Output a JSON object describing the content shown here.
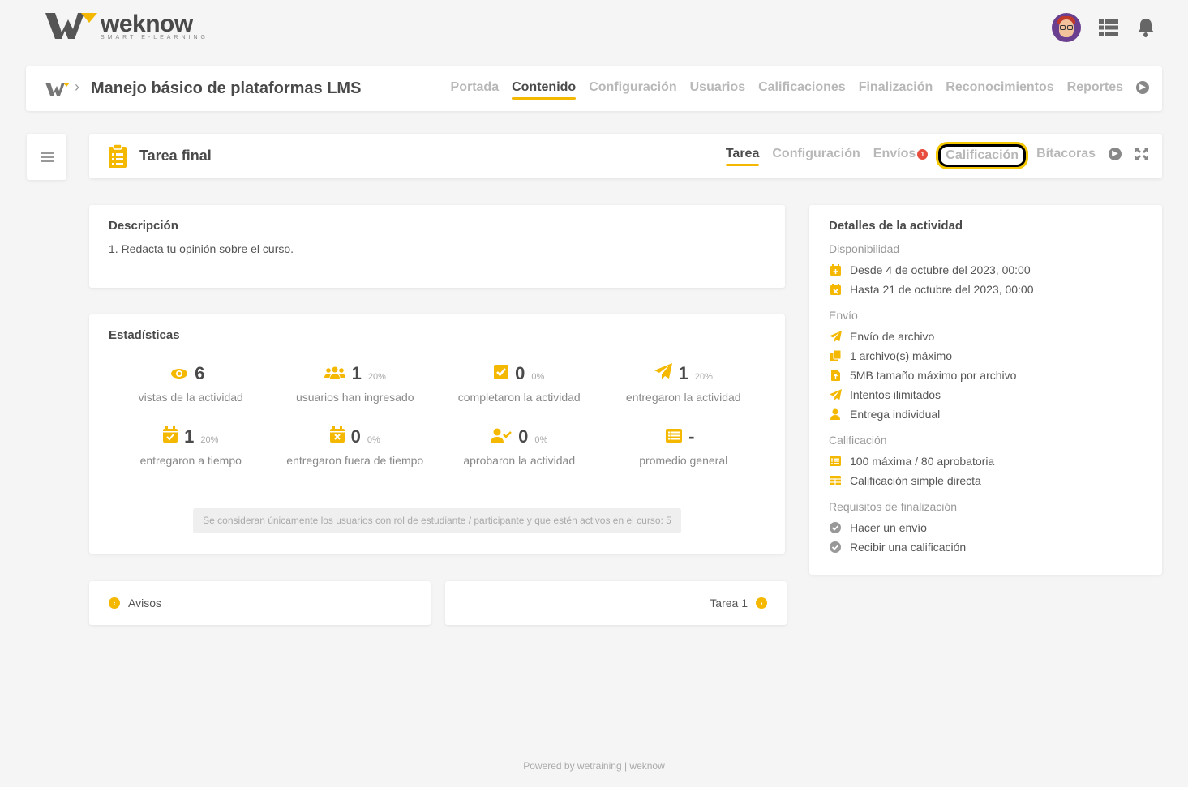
{
  "brand": {
    "name": "weknow",
    "tagline": "SMART E-LEARNING",
    "accent": "#f5b800"
  },
  "header": {
    "avatar_icon": "user-avatar",
    "list_icon": "list-icon",
    "bell_icon": "bell-icon"
  },
  "course": {
    "title": "Manejo básico de plataformas LMS",
    "nav": [
      "Portada",
      "Contenido",
      "Configuración",
      "Usuarios",
      "Calificaciones",
      "Finalización",
      "Reconocimientos",
      "Reportes"
    ],
    "active": "Contenido"
  },
  "activity": {
    "title": "Tarea final",
    "tabs": {
      "tarea": "Tarea",
      "config": "Configuración",
      "envios": "Envíos",
      "envios_badge": "1",
      "calificacion": "Calificación",
      "bitacoras": "Bítacoras"
    }
  },
  "description": {
    "title": "Descripción",
    "text": "1. Redacta tu opinión sobre el curso."
  },
  "stats": {
    "title": "Estadísticas",
    "items": [
      {
        "icon": "eye-icon",
        "num": "6",
        "pct": "",
        "label": "vistas de la actividad"
      },
      {
        "icon": "users-icon",
        "num": "1",
        "pct": "20%",
        "label": "usuarios han ingresado"
      },
      {
        "icon": "check-square-icon",
        "num": "0",
        "pct": "0%",
        "label": "completaron la actividad"
      },
      {
        "icon": "paper-plane-icon",
        "num": "1",
        "pct": "20%",
        "label": "entregaron la actividad"
      },
      {
        "icon": "calendar-check-icon",
        "num": "1",
        "pct": "20%",
        "label": "entregaron a tiempo"
      },
      {
        "icon": "calendar-x-icon",
        "num": "0",
        "pct": "0%",
        "label": "entregaron fuera de tiempo"
      },
      {
        "icon": "user-check-icon",
        "num": "0",
        "pct": "0%",
        "label": "aprobaron la actividad"
      },
      {
        "icon": "list-alt-icon",
        "num": "-",
        "pct": "",
        "label": "promedio general"
      }
    ],
    "note": "Se consideran únicamente los usuarios con rol de estudiante / participante y que estén activos en el curso: 5"
  },
  "details": {
    "title": "Detalles de la actividad",
    "availability_title": "Disponibilidad",
    "from": "Desde 4 de octubre del 2023, 00:00",
    "until": "Hasta 21 de octubre del 2023, 00:00",
    "submission_title": "Envío",
    "sub1": "Envío de archivo",
    "sub2": "1 archivo(s) máximo",
    "sub3": "5MB tamaño máximo por archivo",
    "sub4": "Intentos ilimitados",
    "sub5": "Entrega individual",
    "grading_title": "Calificación",
    "grade1": "100 máxima / 80 aprobatoria",
    "grade2": "Calificación simple directa",
    "completion_title": "Requisitos de finalización",
    "req1": "Hacer un envío",
    "req2": "Recibir una calificación"
  },
  "pager": {
    "prev": "Avisos",
    "next": "Tarea 1"
  },
  "footer": "Powered by wetraining | weknow"
}
